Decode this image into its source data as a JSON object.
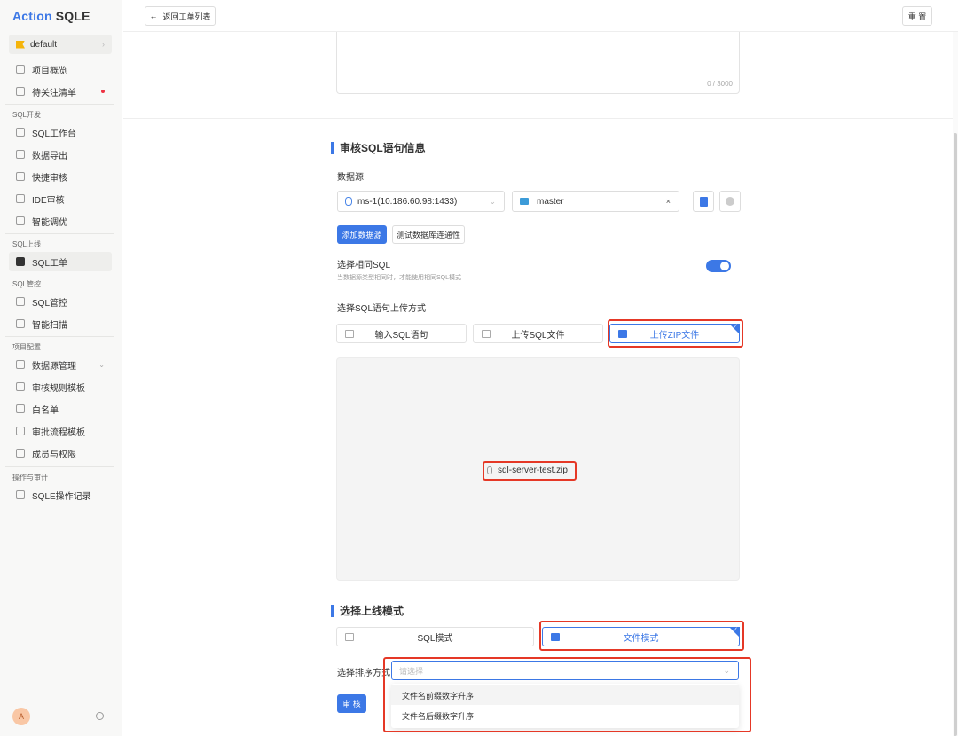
{
  "brand": {
    "part1": "Action",
    "part2": "SQLE"
  },
  "sidebar": {
    "project": "default",
    "groups": {
      "dev": "SQL开发",
      "release": "SQL上线",
      "control": "SQL管控",
      "config": "项目配置",
      "audit": "操作与审计"
    },
    "items": {
      "overview": "项目概览",
      "todo": "待关注清单",
      "workbench": "SQL工作台",
      "export": "数据导出",
      "quick_audit": "快捷审核",
      "ide_audit": "IDE审核",
      "tuning": "智能调优",
      "ticket": "SQL工单",
      "sql_control": "SQL管控",
      "scan": "智能扫描",
      "datasource": "数据源管理",
      "rule_template": "审核规则模板",
      "whitelist": "白名单",
      "flow_template": "审批流程模板",
      "members": "成员与权限",
      "op_log": "SQLE操作记录"
    },
    "avatar": "A"
  },
  "header": {
    "back": "返回工单列表",
    "reset": "重 置"
  },
  "desc": {
    "counter": "0 / 3000"
  },
  "audit": {
    "title": "审核SQL语句信息",
    "datasource_label": "数据源",
    "instance": "ms-1(10.186.60.98:1433)",
    "schema": "master",
    "add_ds": "添加数据源",
    "test_conn": "测试数据库连通性",
    "same_sql_label": "选择相同SQL",
    "same_sql_hint": "当数据源类型相同时，才能使用相同SQL模式",
    "same_sql_enabled": true,
    "upload_label": "选择SQL语句上传方式",
    "upload_options": [
      "输入SQL语句",
      "上传SQL文件",
      "上传ZIP文件"
    ],
    "upload_selected": "上传ZIP文件",
    "file_name": "sql-server-test.zip"
  },
  "release": {
    "title": "选择上线模式",
    "modes": [
      "SQL模式",
      "文件模式"
    ],
    "mode_selected": "文件模式",
    "sort_label": "选择排序方式",
    "sort_placeholder": "请选择",
    "sort_options": [
      "文件名前缀数字升序",
      "文件名后缀数字升序"
    ],
    "submit": "审 核"
  },
  "colors": {
    "accent": "#3c78e6",
    "highlight": "#e53826"
  }
}
